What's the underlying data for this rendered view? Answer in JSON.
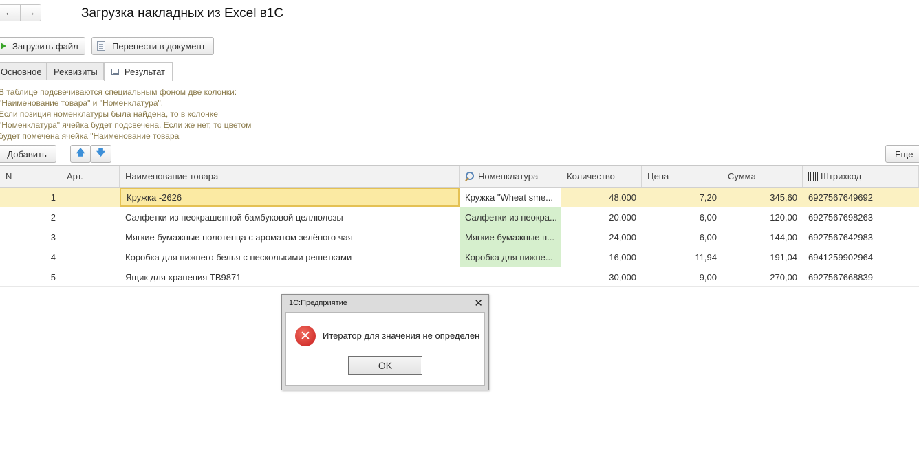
{
  "nav": {
    "back_icon": "←",
    "forward_icon": "→"
  },
  "title": "Загрузка накладных из Excel в1С",
  "toolbar": {
    "load_file": "Загрузить файл",
    "transfer_to_document": "Перенести в документ"
  },
  "tabs": [
    {
      "label": "Основное"
    },
    {
      "label": "Реквизиты"
    },
    {
      "label": "Результат",
      "active": true
    }
  ],
  "info_lines": [
    "В таблице подсвечиваются специальным фоном две колонки:",
    "\"Наименование товара\" и \"Номенклатура\".",
    "Если позиция номенклатуры была найдена, то в колонке",
    "\"Номенклатура\" ячейка будет подсвечена. Если же нет, то цветом",
    "будет помечена ячейка \"Наименование товара"
  ],
  "table_toolbar": {
    "add": "Добавить",
    "up_icon": "🡅",
    "down_icon": "🡇",
    "more": "Еще"
  },
  "table": {
    "headers": {
      "n": "N",
      "art": "Арт.",
      "name": "Наименование товара",
      "nomenclature": "Номенклатура",
      "qty": "Количество",
      "price": "Цена",
      "sum": "Сумма",
      "barcode": "Штрихкод"
    },
    "rows": [
      {
        "n": "1",
        "art": "",
        "name": "Кружка -2626",
        "nomenclature": "Кружка \"Wheat sme...",
        "qty": "48,000",
        "price": "7,20",
        "sum": "345,60",
        "barcode": "6927567649692"
      },
      {
        "n": "2",
        "art": "",
        "name": "Салфетки из неокрашенной бамбуковой целлюлозы",
        "nomenclature": "Салфетки из неокра...",
        "qty": "20,000",
        "price": "6,00",
        "sum": "120,00",
        "barcode": "6927567698263"
      },
      {
        "n": "3",
        "art": "",
        "name": "Мягкие бумажные полотенца с ароматом зелёного чая",
        "nomenclature": "Мягкие бумажные п...",
        "qty": "24,000",
        "price": "6,00",
        "sum": "144,00",
        "barcode": "6927567642983"
      },
      {
        "n": "4",
        "art": "",
        "name": "Коробка для нижнего белья с несколькими решетками",
        "nomenclature": "Коробка для нижне...",
        "qty": "16,000",
        "price": "11,94",
        "sum": "191,04",
        "barcode": "6941259902964"
      },
      {
        "n": "5",
        "art": "",
        "name": "Ящик для хранения TB9871",
        "nomenclature": "",
        "qty": "30,000",
        "price": "9,00",
        "sum": "270,00",
        "barcode": "6927567668839"
      }
    ]
  },
  "dialog": {
    "title": "1С:Предприятие",
    "close_icon": "✕",
    "error_icon": "✕",
    "message": "Итератор для значения не определен",
    "ok": "OK"
  },
  "colors": {
    "selected_row": "#fbf1c2",
    "found_cell": "#d6efcd",
    "info_text": "#8a7a4a",
    "error": "#d0302a"
  }
}
